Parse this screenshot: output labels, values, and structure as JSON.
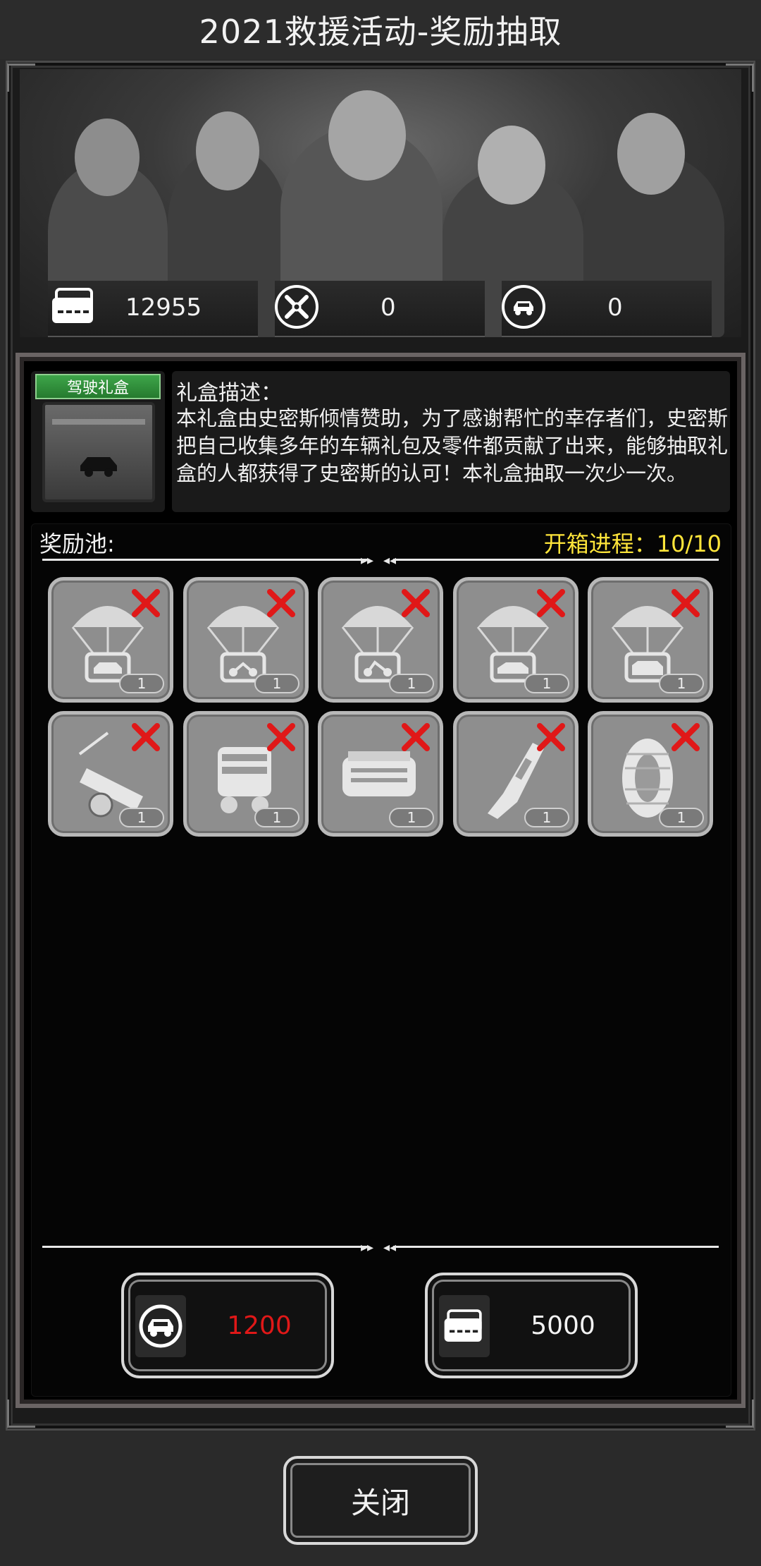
{
  "title": "2021救援活动-奖励抽取",
  "currencies": [
    {
      "icon": "ticket-icon",
      "value": "12955"
    },
    {
      "icon": "wrench-cross-icon",
      "value": "0"
    },
    {
      "icon": "car-coin-icon",
      "value": "0"
    }
  ],
  "gift": {
    "label": "驾驶礼盒",
    "desc_title": "礼盒描述：",
    "desc_text": "本礼盒由史密斯倾情赞助，为了感谢帮忙的幸存者们，史密斯把自己收集多年的车辆礼包及零件都贡献了出来，能够抽取礼盒的人都获得了史密斯的认可！本礼盒抽取一次少一次。"
  },
  "pool": {
    "label": "奖励池:",
    "progress": "开箱进程：10/10",
    "items": [
      {
        "icon": "parachute-car-icon",
        "count": "1",
        "claimed": true
      },
      {
        "icon": "parachute-motorbike-icon",
        "count": "1",
        "claimed": true
      },
      {
        "icon": "parachute-motorbike-icon",
        "count": "1",
        "claimed": true
      },
      {
        "icon": "parachute-car-icon",
        "count": "1",
        "claimed": true
      },
      {
        "icon": "parachute-suv-icon",
        "count": "1",
        "claimed": true
      },
      {
        "icon": "trailer-icon",
        "count": "1",
        "claimed": true
      },
      {
        "icon": "engine-icon",
        "count": "1",
        "claimed": true
      },
      {
        "icon": "engine-block-icon",
        "count": "1",
        "claimed": true
      },
      {
        "icon": "shock-absorber-icon",
        "count": "1",
        "claimed": true
      },
      {
        "icon": "tire-icon",
        "count": "1",
        "claimed": true
      }
    ]
  },
  "costs": [
    {
      "icon": "car-coin-icon",
      "value": "1200",
      "color": "#e01818"
    },
    {
      "icon": "ticket-icon",
      "value": "5000",
      "color": "#f2f2f2"
    }
  ],
  "close_label": "关闭"
}
